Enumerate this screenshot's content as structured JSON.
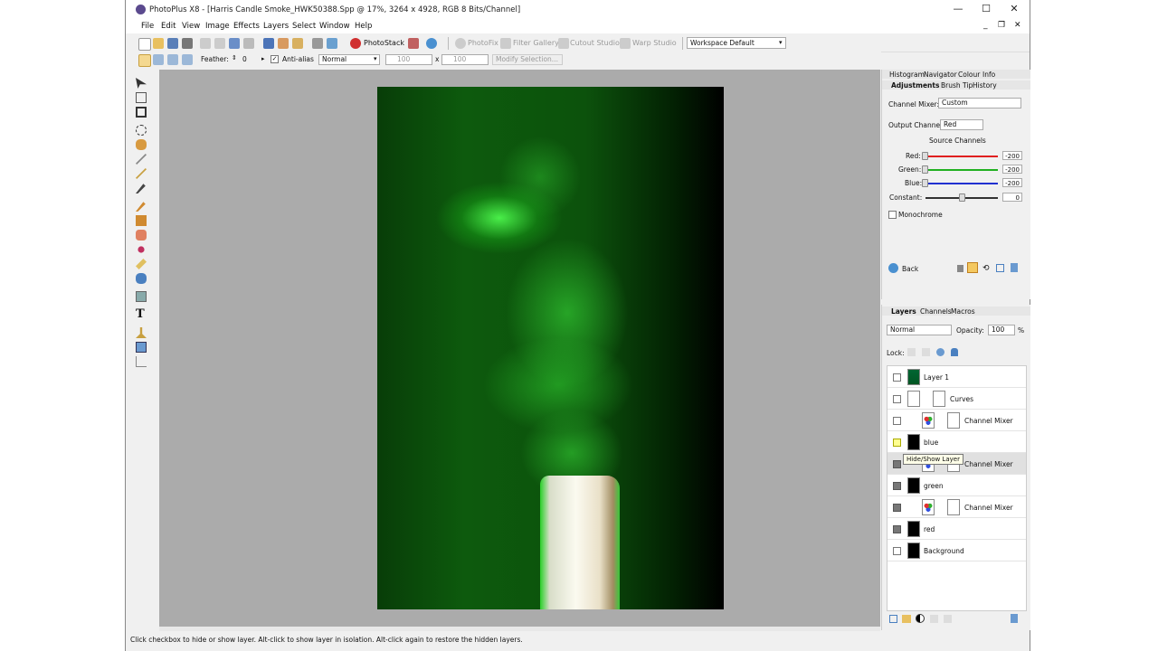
{
  "window": {
    "title": "PhotoPlus X8 - [Harris Candle Smoke_HWK50388.Spp @ 17%, 3264 x 4928, RGB 8 Bits/Channel]",
    "minimize": "—",
    "maximize": "☐",
    "close": "✕"
  },
  "menu": [
    "File",
    "Edit",
    "View",
    "Image",
    "Effects",
    "Layers",
    "Select",
    "Window",
    "Help"
  ],
  "toolbar": {
    "photostack": "PhotoStack",
    "photofix": "PhotoFix",
    "filter_gallery": "Filter Gallery",
    "cutout_studio": "Cutout Studio",
    "warp_studio": "Warp Studio",
    "workspace": "Workspace  Default"
  },
  "context_bar": {
    "feather_label": "Feather:",
    "feather_value": "0",
    "antialias_label": "Anti-alias",
    "blend_mode": "Normal",
    "width_value": "100",
    "x_label": "x",
    "height_value": "100",
    "modify_selection": "Modify Selection..."
  },
  "top_panel": {
    "tabs": [
      "Histogram",
      "Navigator",
      "Colour",
      "Info"
    ],
    "subtabs": [
      "Adjustments",
      "Brush Tip",
      "History"
    ],
    "channel_mixer_label": "Channel Mixer:",
    "channel_mixer_value": "Custom",
    "output_channel_label": "Output Channel:",
    "output_channel_value": "Red",
    "source_channels_heading": "Source Channels",
    "sliders": [
      {
        "label": "Red:",
        "value": "-200",
        "color": "#e02020"
      },
      {
        "label": "Green:",
        "value": "-200",
        "color": "#20b020"
      },
      {
        "label": "Blue:",
        "value": "-200",
        "color": "#2030d0"
      },
      {
        "label": "Constant:",
        "value": "0",
        "color": "#333333"
      }
    ],
    "monochrome_label": "Monochrome",
    "back_label": "Back"
  },
  "layers_panel": {
    "tabs": [
      "Layers",
      "Channels",
      "Macros"
    ],
    "blend_mode": "Normal",
    "opacity_label": "Opacity:",
    "opacity_value": "100",
    "opacity_unit": "%",
    "lock_label": "Lock:",
    "tooltip": "Hide/Show Layer",
    "layers": [
      {
        "name": "Layer  1",
        "visible": false
      },
      {
        "name": "Curves",
        "visible": false
      },
      {
        "name": "Channel Mixer",
        "visible": false
      },
      {
        "name": "blue",
        "visible": false
      },
      {
        "name": "Channel Mixer",
        "visible": true
      },
      {
        "name": "green",
        "visible": true
      },
      {
        "name": "Channel Mixer",
        "visible": true
      },
      {
        "name": "red",
        "visible": true
      },
      {
        "name": "Background",
        "visible": false
      }
    ]
  },
  "status_bar": {
    "text": "Click checkbox to hide or show layer. Alt-click to show layer in isolation. Alt-click again to restore the hidden layers."
  }
}
